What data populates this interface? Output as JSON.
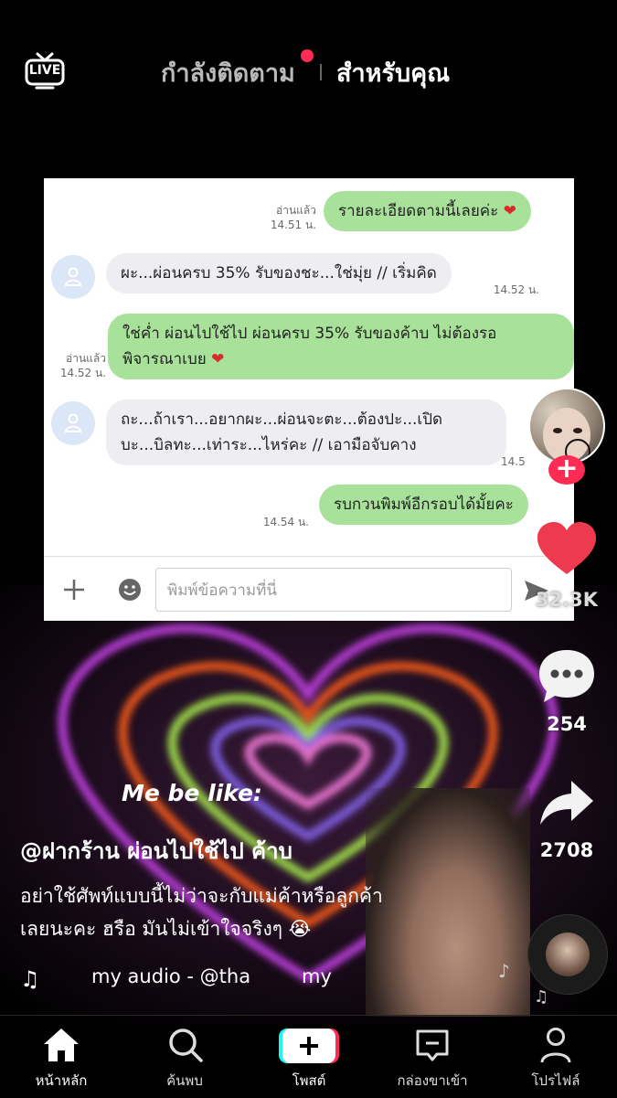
{
  "top_bar": {
    "live_label": "LIVE",
    "tab_following": "กำลังติดตาม",
    "tab_foryou": "สำหรับคุณ"
  },
  "chat": {
    "messages": [
      {
        "from": "me",
        "text": "รายละเอียดตามนี้เลยค่ะ",
        "heart": true,
        "read": "อ่านแล้ว",
        "time": "14.51 น."
      },
      {
        "from": "them",
        "text": "ผะ...ผ่อนครบ 35% รับของชะ...ใช่มุ่ย // เริ่มคิด",
        "time": "14.52 น."
      },
      {
        "from": "me",
        "line1": "ใช่ค่ำ ผ่อนไปใช้ไป ผ่อนครบ 35% รับของค้าบ ไม่ต้องรอ",
        "line2": "พิจารณาเบย",
        "heart": true,
        "read": "อ่านแล้ว",
        "time": "14.52 น."
      },
      {
        "from": "them",
        "line1": "ถะ...ถ้าเรา...อยากผะ...ผ่อนจะตะ...ต้องปะ...เปิด",
        "line2": "บะ...บิลทะ...เท่าระ...ไหร่คะ // เอามือจับคาง",
        "time": "14.5"
      },
      {
        "from": "me",
        "text": "รบกวนพิมพ์อีกรอบได้มั้ยคะ",
        "time": "14.54 น."
      }
    ],
    "input_placeholder": "พิมพ์ข้อความที่นี่"
  },
  "sidebar": {
    "like_count": "32.3K",
    "comment_count": "254",
    "share_count": "2708"
  },
  "video_overlay": {
    "text": "Me be like:"
  },
  "caption": {
    "title": "@ฝากร้าน ผ่อนไปใช้ไป ค้าบ",
    "line1": "อย่าใช้ศัพท์แบบนี้ไม่ว่าจะกับแม่ค้าหรือลูกค้า",
    "line2": "เลยนะคะ ฮรือ มันไม่เข้าใจจริงๆ 😭",
    "audio": "my audio - @tha",
    "audio_extra": "my"
  },
  "bottom_nav": {
    "home": "หน้าหลัก",
    "discover": "ค้นพบ",
    "post": "โพสต์",
    "inbox": "กล่องขาเข้า",
    "profile": "โปรไฟล์"
  },
  "colors": {
    "accent": "#fe2c55",
    "bubble_me": "#a8e29a",
    "bubble_them": "#eeeef2"
  }
}
